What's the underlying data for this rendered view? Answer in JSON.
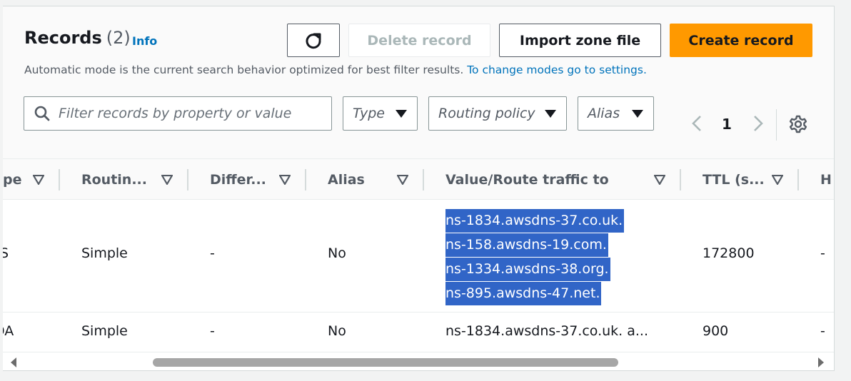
{
  "header": {
    "title": "Records",
    "count": "(2)",
    "info": "Info",
    "subtitle": "Automatic mode is the current search behavior optimized for best filter results.",
    "subtitle_link": "To change modes go to settings."
  },
  "buttons": {
    "delete": "Delete record",
    "import": "Import zone file",
    "create": "Create record"
  },
  "filters": {
    "search_placeholder": "Filter records by property or value",
    "type": "Type",
    "routing_policy": "Routing policy",
    "alias": "Alias"
  },
  "pagination": {
    "page": "1"
  },
  "table": {
    "columns": [
      "pe",
      "Routin...",
      "Differ...",
      "Alias",
      "Value/Route traffic to",
      "TTL (s...",
      "H"
    ],
    "rows": [
      {
        "type": "S",
        "routing": "Simple",
        "differ": "-",
        "alias": "No",
        "values": [
          "ns-1834.awsdns-37.co.uk.",
          "ns-158.awsdns-19.com.",
          "ns-1334.awsdns-38.org.",
          "ns-895.awsdns-47.net."
        ],
        "ttl": "172800",
        "health": "-"
      },
      {
        "type": "DA",
        "routing": "Simple",
        "differ": "-",
        "alias": "No",
        "value": "ns-1834.awsdns-37.co.uk. a...",
        "ttl": "900",
        "health": "-"
      }
    ]
  },
  "colors": {
    "accent_orange": "#ff9900",
    "link_blue": "#0073bb",
    "selection_blue": "#3165c7"
  }
}
